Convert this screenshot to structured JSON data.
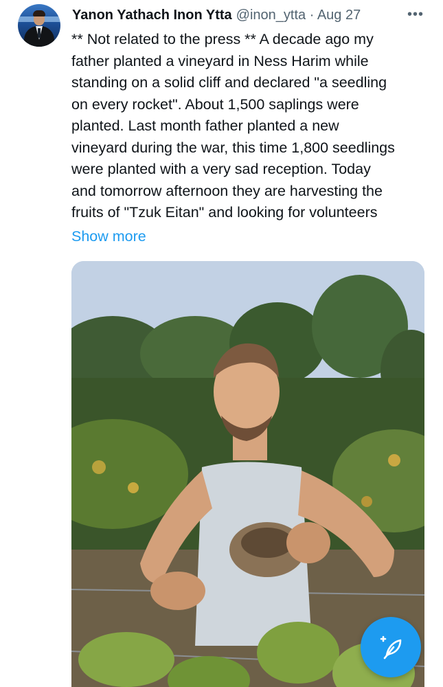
{
  "tweet": {
    "author_name": "Yanon Yathach Inon Ytta",
    "handle": "@inon_ytta",
    "separator": "·",
    "date": "Aug 27",
    "more_icon": "•••",
    "lines": [
      "** Not related to the press ** A decade ago my",
      "father planted a vineyard in Ness Harim while",
      "standing on a solid cliff and declared \"a seedling",
      "on every rocket\". About 1,500 saplings were",
      "planted. Last month father planted a new",
      "vineyard during the war, this time 1,800 seedlings",
      "were planted with a very sad reception. Today",
      "and tomorrow afternoon they are harvesting the",
      "fruits of \"Tzuk Eitan\" and looking for volunteers"
    ],
    "show_more": "Show more"
  },
  "media": {
    "icon": "photo-young-man-holding-bird-nest-in-vineyard"
  },
  "fab": {
    "icon": "compose-feather-plus-icon"
  },
  "colors": {
    "accent": "#1d9bf0",
    "text": "#0f1419",
    "secondary": "#536471"
  }
}
